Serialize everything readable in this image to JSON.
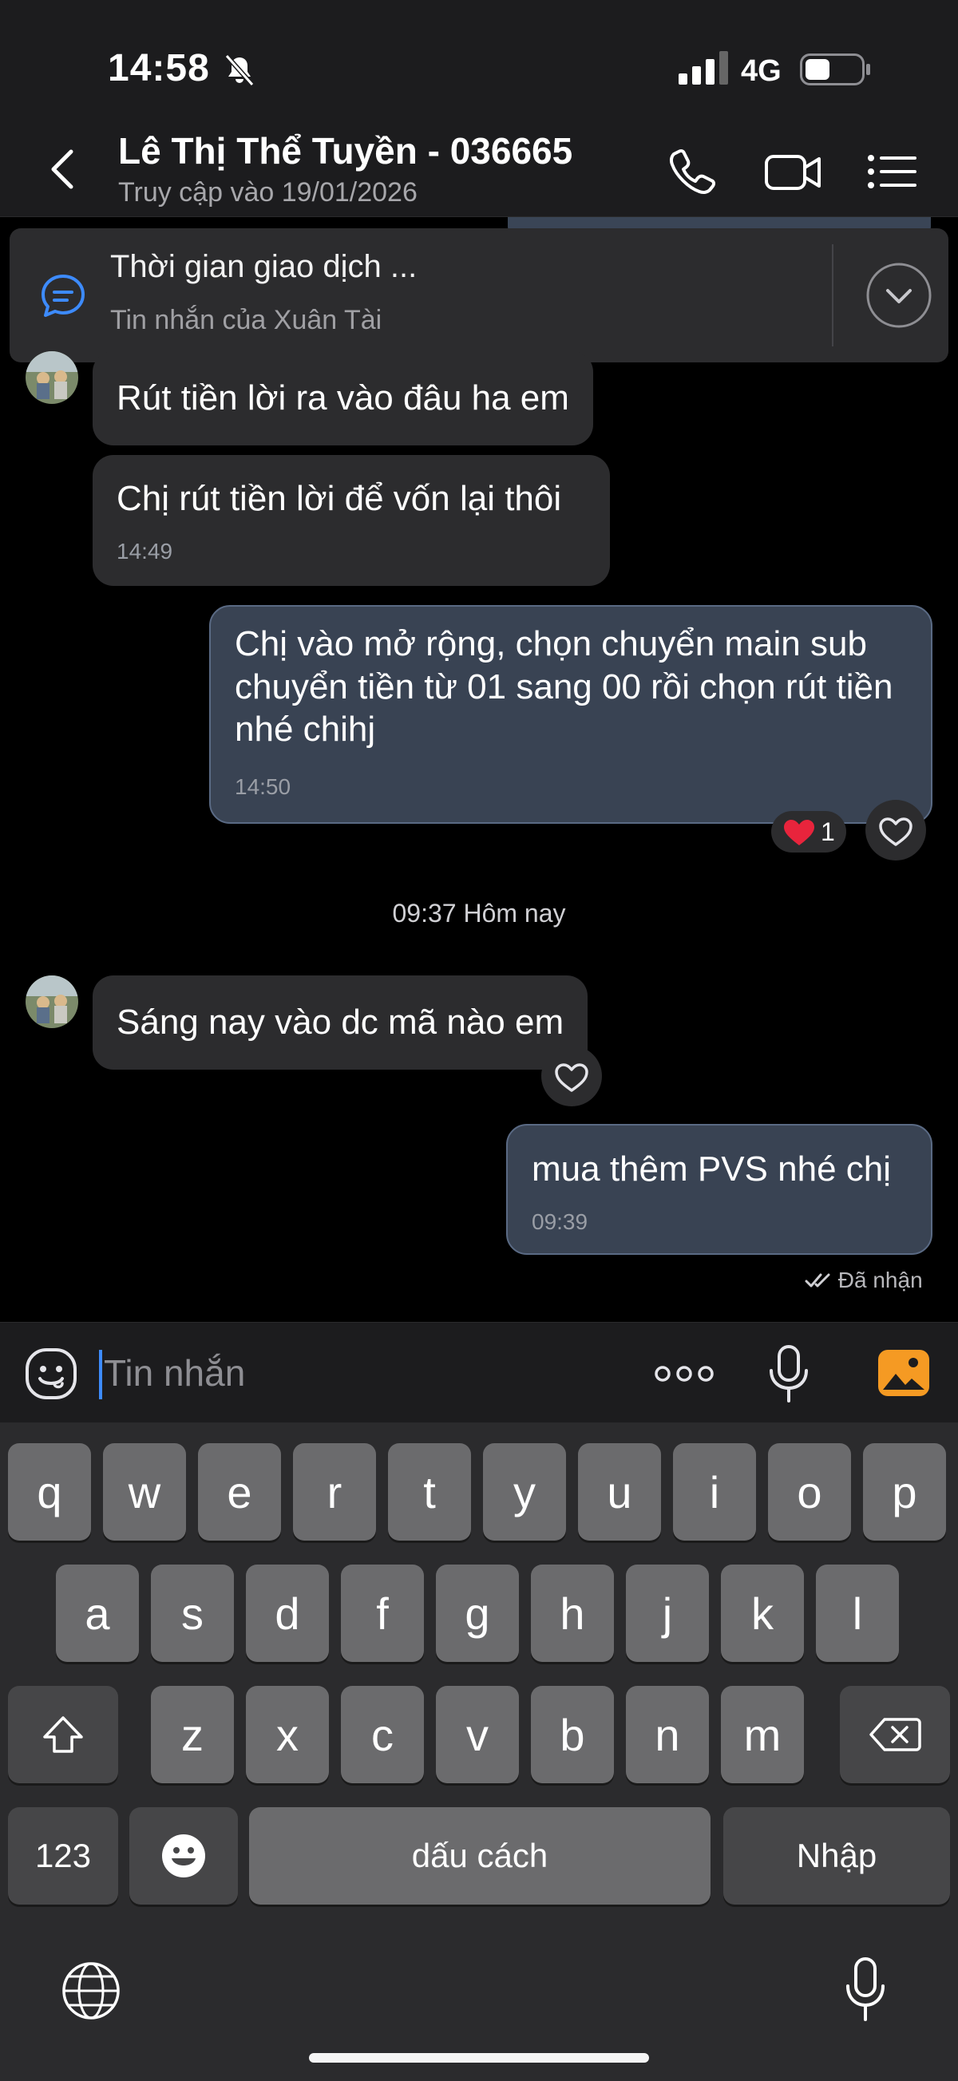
{
  "status_bar": {
    "time": "14:58",
    "network": "4G"
  },
  "header": {
    "contact_name": "Lê Thị Thể Tuyền - 036665",
    "last_seen": "Truy cập vào 19/01/2026"
  },
  "pinned": {
    "title": "Thời gian giao dịch ...",
    "subtitle": "Tin nhắn của Xuân Tài"
  },
  "messages": [
    {
      "direction": "in",
      "text": "Rút tiền lời ra vào đâu ha em",
      "time": ""
    },
    {
      "direction": "in",
      "text": "Chị rút tiền lời để vốn lại thôi",
      "time": "14:49"
    },
    {
      "direction": "out",
      "text": "Chị vào mở rộng, chọn chuyển main sub chuyển tiền từ 01 sang 00 rồi chọn rút tiền nhé chihj",
      "time": "14:50",
      "reaction_count": "1"
    },
    {
      "direction": "in",
      "text": "Sáng nay vào dc mã nào em",
      "time": ""
    },
    {
      "direction": "out",
      "text": "mua thêm PVS nhé chị",
      "time": "09:39"
    }
  ],
  "date_separator": "09:37 Hôm nay",
  "delivery_status": "Đã nhận",
  "composer": {
    "placeholder": "Tin nhắn"
  },
  "keyboard": {
    "row1": [
      "q",
      "w",
      "e",
      "r",
      "t",
      "y",
      "u",
      "i",
      "o",
      "p"
    ],
    "row2": [
      "a",
      "s",
      "d",
      "f",
      "g",
      "h",
      "j",
      "k",
      "l"
    ],
    "row3": [
      "z",
      "x",
      "c",
      "v",
      "b",
      "n",
      "m"
    ],
    "numbers_key": "123",
    "space_key": "dấu cách",
    "return_key": "Nhập"
  },
  "colors": {
    "accent": "#3d8bfd",
    "outgoing_bubble": "#394353",
    "incoming_bubble": "#2c2c2e",
    "reaction_heart": "#e8243c",
    "photo_icon": "#f59a23"
  }
}
